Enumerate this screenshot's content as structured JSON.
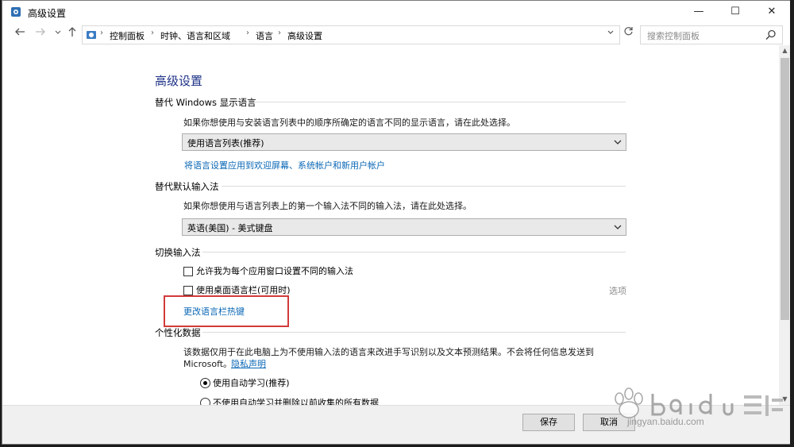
{
  "window": {
    "title": "高级设置",
    "min_glyph": "—",
    "max_glyph": "☐",
    "close_glyph": "✕"
  },
  "nav": {
    "back_icon": "arrow-left-icon",
    "forward_icon": "arrow-right-icon",
    "up_icon": "arrow-up-icon",
    "breadcrumbs": [
      "控制面板",
      "时钟、语言和区域",
      "语言",
      "高级设置"
    ],
    "refresh_icon": "refresh-icon",
    "search_placeholder": "搜索控制面板"
  },
  "page": {
    "title": "高级设置",
    "section1": {
      "title": "替代 Windows 显示语言",
      "desc": "如果你想使用与安装语言列表中的顺序所确定的语言不同的显示语言，请在此处选择。",
      "combo_value": "使用语言列表(推荐)",
      "link": "将语言设置应用到欢迎屏幕、系统帐户和新用户帐户"
    },
    "section2": {
      "title": "替代默认输入法",
      "desc": "如果你想使用与语言列表上的第一个输入法不同的输入法，请在此处选择。",
      "combo_value": "英语(美国) - 美式键盘"
    },
    "section3": {
      "title": "切换输入法",
      "checkbox1": "允许我为每个应用窗口设置不同的输入法",
      "checkbox2": "使用桌面语言栏(可用时)",
      "options": "选项",
      "hotkey_link": "更改语言栏热键"
    },
    "section4": {
      "title": "个性化数据",
      "desc_line1": "该数据仅用于在此电脑上为不使用输入法的语言来改进手写识别以及文本预测结果。不会将任何信息发送到",
      "desc_line2": "Microsoft。",
      "privacy_link": "隐私声明",
      "radio1": "使用自动学习(推荐)",
      "radio2": "不使用自动学习并删除以前收集的所有数据"
    }
  },
  "footer": {
    "save": "保存",
    "cancel": "取消"
  },
  "watermark": {
    "text": "jingyan.baidu.com"
  },
  "colors": {
    "title_blue": "#1e3287",
    "link_blue": "#0a67b6",
    "highlight_red": "#d23a3a"
  }
}
